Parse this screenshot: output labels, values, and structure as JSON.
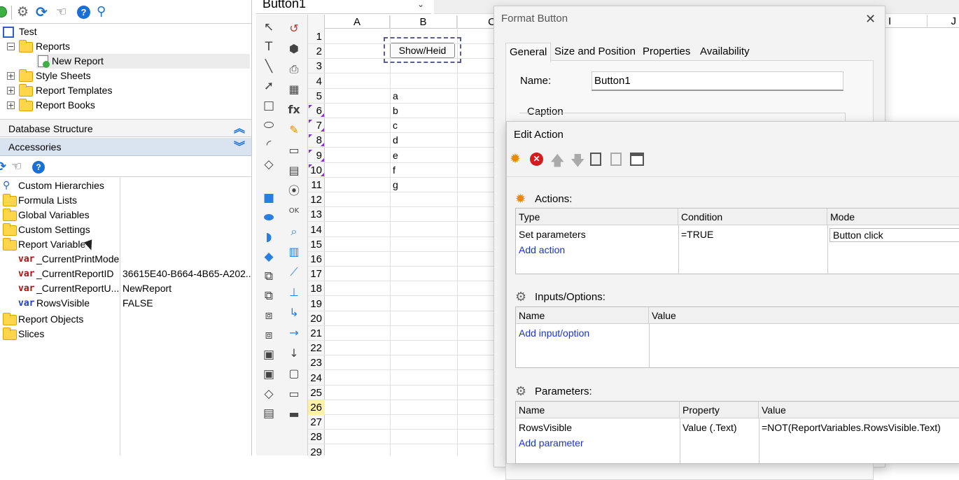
{
  "left_panel": {
    "toolbar_icons": [
      "add-icon",
      "gear-icon",
      "refresh-icon",
      "pointer-hand-icon",
      "help-icon",
      "search-icon"
    ],
    "tree": {
      "root": "Test",
      "reports_folder": "Reports",
      "new_report": "New Report",
      "style_sheets": "Style Sheets",
      "report_templates": "Report Templates",
      "report_books": "Report Books"
    },
    "database_structure": "Database Structure",
    "accessories": "Accessories",
    "accessories_items": {
      "custom_hierarchies": "Custom Hierarchies",
      "formula_lists": "Formula Lists",
      "global_variables": "Global Variables",
      "custom_settings": "Custom Settings",
      "report_variables": "Report Variables",
      "report_objects": "Report Objects",
      "slices": "Slices"
    },
    "var_prefix": "var",
    "variables": [
      {
        "name": "_CurrentPrintMode",
        "value": ""
      },
      {
        "name": "_CurrentReportID",
        "value": "36615E40-B664-4B65-A202..."
      },
      {
        "name": "_CurrentReportU...",
        "value": "NewReport"
      },
      {
        "name": "RowsVisible",
        "value": "FALSE"
      }
    ]
  },
  "sheet": {
    "name_box": "Button1",
    "columns": [
      "A",
      "B",
      "C"
    ],
    "rows": [
      "1",
      "2",
      "3",
      "4",
      "5",
      "6",
      "7",
      "8",
      "9",
      "10",
      "11",
      "12",
      "13",
      "14",
      "15",
      "16",
      "17",
      "18",
      "19",
      "20",
      "21",
      "22",
      "23",
      "24",
      "25",
      "26",
      "27",
      "28",
      "29"
    ],
    "cells_b": {
      "5": "a",
      "6": "b",
      "7": "c",
      "8": "d",
      "9": "e",
      "10": "f",
      "11": "g"
    },
    "button_label": "Show/Heid",
    "highlighted_row": "26",
    "right_columns": [
      "I",
      "J"
    ]
  },
  "format_button": {
    "title": "Format Button",
    "close": "✕",
    "tabs": [
      "General",
      "Size and Position",
      "Properties",
      "Availability"
    ],
    "name_label": "Name:",
    "name_value": "Button1",
    "caption_label": "Caption"
  },
  "edit_action": {
    "title": "Edit Action",
    "toolbar_icons": [
      "new-action-icon",
      "delete-icon",
      "move-up-icon",
      "move-down-icon",
      "copy-icon",
      "paste-icon",
      "settings-table-icon"
    ],
    "actions_label": "Actions:",
    "actions_headers": [
      "Type",
      "Condition",
      "Mode"
    ],
    "actions_rows": [
      {
        "type": "Set parameters",
        "condition": "=TRUE",
        "mode": "Button click"
      }
    ],
    "add_action": "Add action",
    "inputs_label": "Inputs/Options:",
    "inputs_headers": [
      "Name",
      "Value"
    ],
    "add_input": "Add input/option",
    "parameters_label": "Parameters:",
    "parameters_headers": [
      "Name",
      "Property",
      "Value"
    ],
    "parameters_rows": [
      {
        "name": "RowsVisible",
        "property": "Value (.Text)",
        "value": "=NOT(ReportVariables.RowsVisible.Text)"
      }
    ],
    "add_parameter": "Add parameter"
  },
  "colors": {
    "accent": "#1a6fd6",
    "folder": "#ffd54a",
    "var_red": "#b01010",
    "link": "#1a33d6",
    "highlight_row": "#fff2a8"
  }
}
